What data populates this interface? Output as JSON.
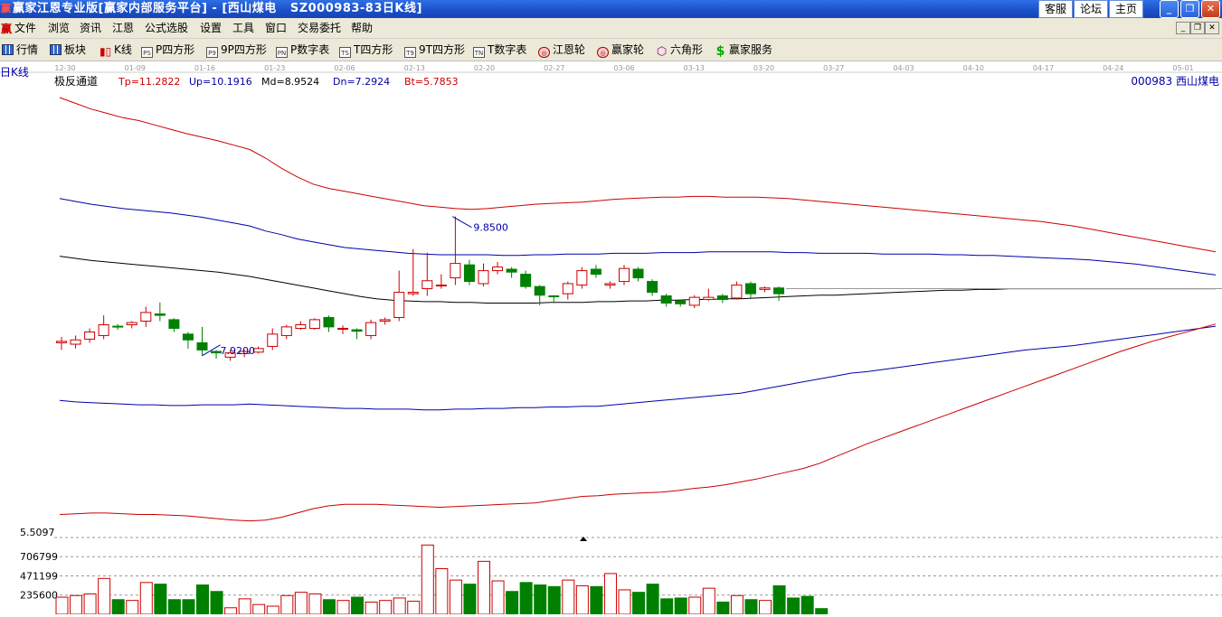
{
  "window": {
    "app_icon": "赢",
    "title": "赢家江恩专业版[赢家内部服务平台] - [西山煤电   SZ000983-83日K线]",
    "buttons": [
      "客服",
      "论坛",
      "主页"
    ]
  },
  "menu": {
    "icon": "赢",
    "items": [
      "文件",
      "浏览",
      "资讯",
      "江恩",
      "公式选股",
      "设置",
      "工具",
      "窗口",
      "交易委托",
      "帮助"
    ]
  },
  "toolbar": [
    {
      "label": "行情",
      "icon": "grid-icon"
    },
    {
      "label": "板块",
      "icon": "grid-icon"
    },
    {
      "label": "K线",
      "icon": "candlestick-icon"
    },
    {
      "label": "P四方形",
      "icon": "ps-icon",
      "glyph": "PS"
    },
    {
      "label": "9P四方形",
      "icon": "p9-icon",
      "glyph": "P9"
    },
    {
      "label": "P数字表",
      "icon": "pn-icon",
      "glyph": "PN"
    },
    {
      "label": "T四方形",
      "icon": "ts-icon",
      "glyph": "TS"
    },
    {
      "label": "9T四方形",
      "icon": "t9-icon",
      "glyph": "T9"
    },
    {
      "label": "T数字表",
      "icon": "tn-icon",
      "glyph": "TN"
    },
    {
      "label": "江恩轮",
      "icon": "gann-wheel-icon"
    },
    {
      "label": "赢家轮",
      "icon": "win-wheel-icon"
    },
    {
      "label": "六角形",
      "icon": "hexagon-icon"
    },
    {
      "label": "赢家服务",
      "icon": "dollar-icon"
    }
  ],
  "chart_header": {
    "left_label": "日K线",
    "indicator": "极反通道",
    "tp": "Tp=11.2822",
    "up": "Up=10.1916",
    "md": "Md=8.9524",
    "dn": "Dn=7.2924",
    "bt": "Bt=5.7853",
    "stock": "000983  西山煤电"
  },
  "colors": {
    "up_candle": "#cc0000",
    "down_candle": "#008000",
    "outer_band": "#cc0000",
    "inner_band": "#0000aa",
    "mid_line": "#000000"
  },
  "chart_data": {
    "type": "candlestick",
    "date_ticks": [
      "12-30",
      "01-09",
      "01-16",
      "01-23",
      "02-06",
      "02-13",
      "02-20",
      "02-27",
      "03-06",
      "03-13",
      "03-20",
      "03-27",
      "04-03",
      "04-10",
      "04-17",
      "04-24",
      "05-01"
    ],
    "price_range": [
      5.4,
      11.6
    ],
    "annotations": [
      {
        "text": "9.8500",
        "value": 9.85
      },
      {
        "text": "7.9200",
        "value": 7.92
      }
    ],
    "candles": [
      [
        8.1,
        8.12,
        8.0,
        8.18
      ],
      [
        8.08,
        8.14,
        8.02,
        8.2
      ],
      [
        8.15,
        8.25,
        8.1,
        8.3
      ],
      [
        8.2,
        8.35,
        8.15,
        8.48
      ],
      [
        8.33,
        8.32,
        8.28,
        8.36
      ],
      [
        8.35,
        8.38,
        8.3,
        8.4
      ],
      [
        8.4,
        8.52,
        8.32,
        8.6
      ],
      [
        8.5,
        8.48,
        8.4,
        8.66
      ],
      [
        8.42,
        8.3,
        8.25,
        8.44
      ],
      [
        8.22,
        8.14,
        8.02,
        8.25
      ],
      [
        8.1,
        8.0,
        7.92,
        8.32
      ],
      [
        7.98,
        7.96,
        7.88,
        8.0
      ],
      [
        7.9,
        7.96,
        7.85,
        8.0
      ],
      [
        7.95,
        7.98,
        7.9,
        8.0
      ],
      [
        7.97,
        8.02,
        7.95,
        8.05
      ],
      [
        8.05,
        8.22,
        8.0,
        8.3
      ],
      [
        8.2,
        8.32,
        8.15,
        8.35
      ],
      [
        8.3,
        8.35,
        8.28,
        8.4
      ],
      [
        8.3,
        8.42,
        8.28,
        8.44
      ],
      [
        8.45,
        8.32,
        8.25,
        8.48
      ],
      [
        8.3,
        8.3,
        8.22,
        8.34
      ],
      [
        8.28,
        8.26,
        8.15,
        8.3
      ],
      [
        8.2,
        8.38,
        8.15,
        8.42
      ],
      [
        8.4,
        8.42,
        8.35,
        8.45
      ],
      [
        8.45,
        8.8,
        8.4,
        9.1
      ],
      [
        8.78,
        8.8,
        8.75,
        9.4
      ],
      [
        8.85,
        8.96,
        8.75,
        9.35
      ],
      [
        8.9,
        8.9,
        8.85,
        9.05
      ],
      [
        9.0,
        9.2,
        8.9,
        9.85
      ],
      [
        9.18,
        8.95,
        8.9,
        9.25
      ],
      [
        8.92,
        9.1,
        8.88,
        9.2
      ],
      [
        9.1,
        9.15,
        9.05,
        9.22
      ],
      [
        9.12,
        9.08,
        9.0,
        9.15
      ],
      [
        9.05,
        8.88,
        8.85,
        9.1
      ],
      [
        8.88,
        8.76,
        8.62,
        8.9
      ],
      [
        8.75,
        8.74,
        8.65,
        8.76
      ],
      [
        8.78,
        8.92,
        8.7,
        8.95
      ],
      [
        8.9,
        9.1,
        8.85,
        9.15
      ],
      [
        9.12,
        9.05,
        9.0,
        9.18
      ],
      [
        8.9,
        8.92,
        8.85,
        8.95
      ],
      [
        8.95,
        9.13,
        8.9,
        9.18
      ],
      [
        9.12,
        9.0,
        8.95,
        9.15
      ],
      [
        8.95,
        8.8,
        8.75,
        8.98
      ],
      [
        8.75,
        8.65,
        8.6,
        8.78
      ],
      [
        8.68,
        8.64,
        8.6,
        8.7
      ],
      [
        8.62,
        8.73,
        8.58,
        8.76
      ],
      [
        8.7,
        8.73,
        8.68,
        8.85
      ],
      [
        8.75,
        8.7,
        8.65,
        8.78
      ],
      [
        8.72,
        8.9,
        8.7,
        8.95
      ],
      [
        8.92,
        8.78,
        8.72,
        8.95
      ],
      [
        8.84,
        8.86,
        8.8,
        8.88
      ],
      [
        8.86,
        8.78,
        8.68,
        8.88
      ]
    ],
    "bands": {
      "tp": [
        11.5,
        11.42,
        11.34,
        11.28,
        11.22,
        11.18,
        11.12,
        11.06,
        11.0,
        10.95,
        10.9,
        10.84,
        10.78,
        10.66,
        10.52,
        10.4,
        10.3,
        10.24,
        10.2,
        10.16,
        10.12,
        10.08,
        10.04,
        10.0,
        9.98,
        9.96,
        9.95,
        9.96,
        9.98,
        10.0,
        10.02,
        10.03,
        10.04,
        10.05,
        10.07,
        10.09,
        10.1,
        10.11,
        10.12,
        10.12,
        10.13,
        10.13,
        10.12,
        10.12,
        10.12,
        10.11,
        10.1,
        10.08,
        10.06,
        10.04,
        10.02,
        10.0,
        9.98,
        9.96,
        9.94,
        9.92,
        9.9,
        9.88,
        9.86,
        9.84,
        9.82,
        9.8,
        9.78,
        9.75,
        9.72,
        9.68,
        9.64,
        9.6,
        9.56,
        9.52,
        9.48,
        9.44,
        9.4,
        9.36
      ],
      "up": [
        10.1,
        10.06,
        10.02,
        9.99,
        9.96,
        9.94,
        9.92,
        9.9,
        9.87,
        9.84,
        9.8,
        9.76,
        9.72,
        9.65,
        9.6,
        9.54,
        9.5,
        9.46,
        9.42,
        9.4,
        9.38,
        9.36,
        9.34,
        9.33,
        9.32,
        9.32,
        9.32,
        9.32,
        9.31,
        9.31,
        9.32,
        9.32,
        9.33,
        9.33,
        9.33,
        9.34,
        9.34,
        9.34,
        9.35,
        9.35,
        9.35,
        9.36,
        9.36,
        9.36,
        9.36,
        9.36,
        9.35,
        9.35,
        9.34,
        9.34,
        9.34,
        9.34,
        9.33,
        9.33,
        9.33,
        9.33,
        9.32,
        9.32,
        9.31,
        9.31,
        9.3,
        9.29,
        9.28,
        9.27,
        9.26,
        9.25,
        9.23,
        9.21,
        9.19,
        9.16,
        9.13,
        9.1,
        9.07,
        9.04
      ],
      "md": [
        9.3,
        9.27,
        9.24,
        9.22,
        9.2,
        9.18,
        9.16,
        9.14,
        9.12,
        9.1,
        9.08,
        9.05,
        9.02,
        8.98,
        8.94,
        8.9,
        8.86,
        8.82,
        8.78,
        8.74,
        8.71,
        8.69,
        8.68,
        8.67,
        8.67,
        8.66,
        8.66,
        8.65,
        8.65,
        8.65,
        8.65,
        8.66,
        8.66,
        8.66,
        8.67,
        8.67,
        8.68,
        8.68,
        8.69,
        8.69,
        8.7,
        8.7,
        8.71,
        8.71,
        8.72,
        8.73,
        8.74,
        8.75,
        8.76,
        8.76,
        8.77,
        8.78,
        8.79,
        8.8,
        8.81,
        8.82,
        8.83,
        8.83,
        8.84,
        8.84,
        8.85,
        8.85,
        8.85,
        8.85,
        8.85,
        8.85,
        8.85,
        8.85,
        8.85,
        8.85,
        8.85,
        8.85,
        8.85,
        8.85
      ],
      "dn": [
        7.3,
        7.28,
        7.27,
        7.26,
        7.25,
        7.24,
        7.24,
        7.23,
        7.23,
        7.24,
        7.24,
        7.24,
        7.25,
        7.24,
        7.23,
        7.22,
        7.21,
        7.2,
        7.19,
        7.19,
        7.18,
        7.18,
        7.18,
        7.17,
        7.17,
        7.18,
        7.18,
        7.19,
        7.19,
        7.2,
        7.2,
        7.21,
        7.21,
        7.22,
        7.22,
        7.24,
        7.26,
        7.28,
        7.3,
        7.32,
        7.34,
        7.36,
        7.38,
        7.4,
        7.44,
        7.48,
        7.52,
        7.56,
        7.6,
        7.64,
        7.68,
        7.7,
        7.73,
        7.76,
        7.79,
        7.82,
        7.85,
        7.88,
        7.91,
        7.94,
        7.97,
        8.0,
        8.02,
        8.04,
        8.06,
        8.09,
        8.12,
        8.15,
        8.18,
        8.21,
        8.24,
        8.27,
        8.3,
        8.33
      ],
      "bt": [
        5.72,
        5.73,
        5.74,
        5.74,
        5.73,
        5.72,
        5.72,
        5.71,
        5.7,
        5.68,
        5.66,
        5.64,
        5.63,
        5.64,
        5.68,
        5.74,
        5.8,
        5.84,
        5.86,
        5.86,
        5.86,
        5.85,
        5.84,
        5.83,
        5.82,
        5.83,
        5.84,
        5.85,
        5.86,
        5.87,
        5.88,
        5.91,
        5.94,
        5.97,
        5.98,
        6.0,
        6.01,
        6.02,
        6.03,
        6.05,
        6.08,
        6.1,
        6.13,
        6.17,
        6.21,
        6.26,
        6.31,
        6.36,
        6.43,
        6.52,
        6.61,
        6.7,
        6.78,
        6.86,
        6.94,
        7.02,
        7.1,
        7.18,
        7.26,
        7.34,
        7.42,
        7.5,
        7.58,
        7.66,
        7.74,
        7.82,
        7.9,
        7.98,
        8.05,
        8.12,
        8.18,
        8.24,
        8.3,
        8.36
      ]
    },
    "volume": {
      "axis_labels": [
        "706799",
        "471199",
        "235600"
      ],
      "axis_values": [
        706799,
        471199,
        235600
      ],
      "max": 942398,
      "values": [
        210000,
        230000,
        250000,
        440000,
        180000,
        170000,
        390000,
        370000,
        180000,
        180000,
        360000,
        280000,
        80000,
        190000,
        120000,
        100000,
        230000,
        270000,
        250000,
        180000,
        170000,
        210000,
        150000,
        170000,
        200000,
        160000,
        850000,
        560000,
        420000,
        370000,
        650000,
        410000,
        280000,
        390000,
        360000,
        340000,
        420000,
        350000,
        340000,
        500000,
        300000,
        270000,
        370000,
        190000,
        200000,
        210000,
        320000,
        150000,
        230000,
        180000,
        170000,
        350000,
        200000,
        220000,
        70000
      ]
    },
    "lower_label": "5.5097",
    "grid": false
  }
}
